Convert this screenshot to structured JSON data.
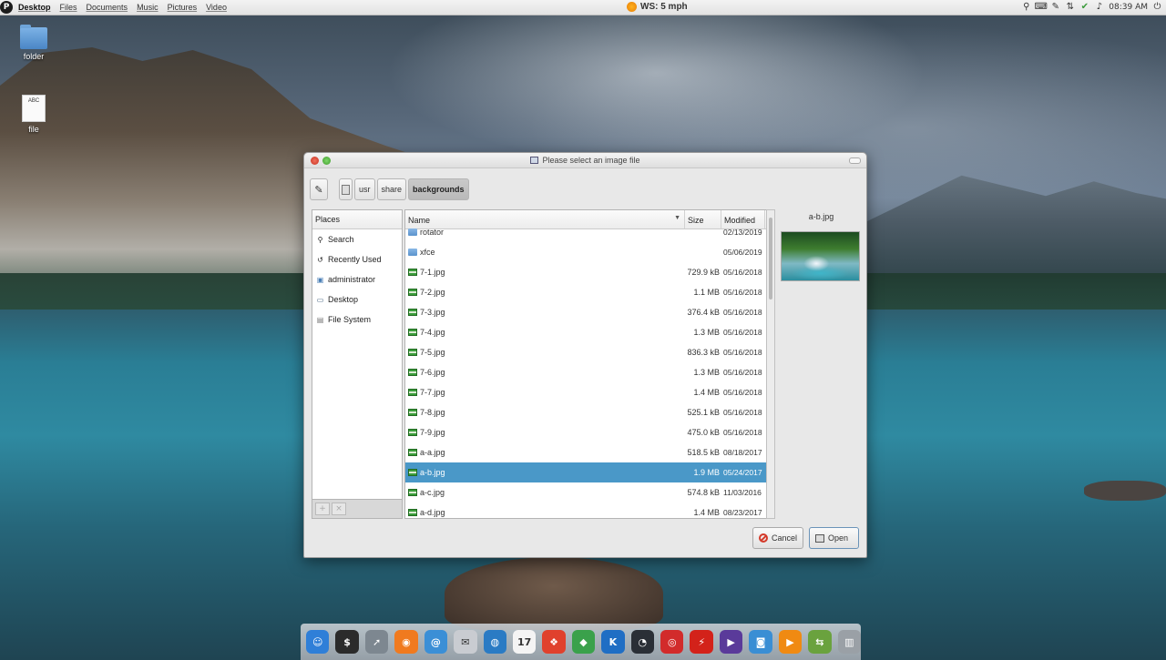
{
  "top_panel": {
    "logo": "P",
    "menu": [
      "Desktop",
      "Files",
      "Documents",
      "Music",
      "Pictures",
      "Video"
    ],
    "weather": "WS: 5 mph",
    "clock": "08:39 AM",
    "tray_icons": [
      "search-icon",
      "keyboard-icon",
      "pen-icon",
      "network-icon",
      "shield-icon",
      "volume-icon",
      "power-icon"
    ]
  },
  "desktop_icons": [
    {
      "label": "folder",
      "icon": "folder-icon"
    },
    {
      "label": "file",
      "icon": "text-file-icon",
      "badge": "ABC"
    }
  ],
  "dialog": {
    "title": "Please select an image file",
    "path": [
      "usr",
      "share",
      "backgrounds"
    ],
    "places_header": "Places",
    "places": [
      {
        "label": "Search",
        "icon": "search-icon"
      },
      {
        "label": "Recently Used",
        "icon": "clock-icon"
      },
      {
        "label": "administrator",
        "icon": "home-folder-icon"
      },
      {
        "label": "Desktop",
        "icon": "desktop-icon"
      },
      {
        "label": "File System",
        "icon": "drive-icon"
      }
    ],
    "columns": {
      "name": "Name",
      "size": "Size",
      "modified": "Modified"
    },
    "files": [
      {
        "name": "rotator",
        "size": "",
        "modified": "02/13/2019",
        "type": "folder"
      },
      {
        "name": "xfce",
        "size": "",
        "modified": "05/06/2019",
        "type": "folder"
      },
      {
        "name": "7-1.jpg",
        "size": "729.9 kB",
        "modified": "05/16/2018",
        "type": "image"
      },
      {
        "name": "7-2.jpg",
        "size": "1.1 MB",
        "modified": "05/16/2018",
        "type": "image"
      },
      {
        "name": "7-3.jpg",
        "size": "376.4 kB",
        "modified": "05/16/2018",
        "type": "image"
      },
      {
        "name": "7-4.jpg",
        "size": "1.3 MB",
        "modified": "05/16/2018",
        "type": "image"
      },
      {
        "name": "7-5.jpg",
        "size": "836.3 kB",
        "modified": "05/16/2018",
        "type": "image"
      },
      {
        "name": "7-6.jpg",
        "size": "1.3 MB",
        "modified": "05/16/2018",
        "type": "image"
      },
      {
        "name": "7-7.jpg",
        "size": "1.4 MB",
        "modified": "05/16/2018",
        "type": "image"
      },
      {
        "name": "7-8.jpg",
        "size": "525.1 kB",
        "modified": "05/16/2018",
        "type": "image"
      },
      {
        "name": "7-9.jpg",
        "size": "475.0 kB",
        "modified": "05/16/2018",
        "type": "image"
      },
      {
        "name": "a-a.jpg",
        "size": "518.5 kB",
        "modified": "08/18/2017",
        "type": "image"
      },
      {
        "name": "a-b.jpg",
        "size": "1.9 MB",
        "modified": "05/24/2017",
        "type": "image",
        "selected": true
      },
      {
        "name": "a-c.jpg",
        "size": "574.8 kB",
        "modified": "11/03/2016",
        "type": "image"
      },
      {
        "name": "a-d.jpg",
        "size": "1.4 MB",
        "modified": "08/23/2017",
        "type": "image"
      }
    ],
    "preview_name": "a-b.jpg",
    "cancel_label": "Cancel",
    "open_label": "Open"
  },
  "dock": [
    {
      "name": "finder-icon",
      "color": "#2f7fd8",
      "glyph": "☺"
    },
    {
      "name": "terminal-icon",
      "color": "#2b2b2b",
      "glyph": "$"
    },
    {
      "name": "launchpad-icon",
      "color": "#7d8790",
      "glyph": "➚"
    },
    {
      "name": "firefox-icon",
      "color": "#f07a1f",
      "glyph": "◉"
    },
    {
      "name": "mail-at-icon",
      "color": "#3b8fd6",
      "glyph": "@"
    },
    {
      "name": "mail-icon",
      "color": "#c9ccd1",
      "glyph": "✉"
    },
    {
      "name": "globe-icon",
      "color": "#2a7bc4",
      "glyph": "◍"
    },
    {
      "name": "calendar-icon",
      "color": "#f4f4f4",
      "glyph": "17"
    },
    {
      "name": "photo-app-icon",
      "color": "#e0412d",
      "glyph": "❖"
    },
    {
      "name": "maps-icon",
      "color": "#3aa14b",
      "glyph": "◆"
    },
    {
      "name": "k-app-icon",
      "color": "#1f6ec4",
      "glyph": "K"
    },
    {
      "name": "timer-icon",
      "color": "#2a2f36",
      "glyph": "◔"
    },
    {
      "name": "lifebuoy-icon",
      "color": "#d22b2b",
      "glyph": "◎"
    },
    {
      "name": "pdf-icon",
      "color": "#d3221a",
      "glyph": "⚡"
    },
    {
      "name": "media-player-icon",
      "color": "#5a3a9a",
      "glyph": "▶"
    },
    {
      "name": "camera-icon",
      "color": "#3a8ed4",
      "glyph": "◙"
    },
    {
      "name": "vlc-icon",
      "color": "#f08a12",
      "glyph": "▶"
    },
    {
      "name": "toggle-app-icon",
      "color": "#6aa23e",
      "glyph": "⇆"
    },
    {
      "name": "trash-icon",
      "color": "#9aa0a6",
      "glyph": "▥"
    }
  ]
}
